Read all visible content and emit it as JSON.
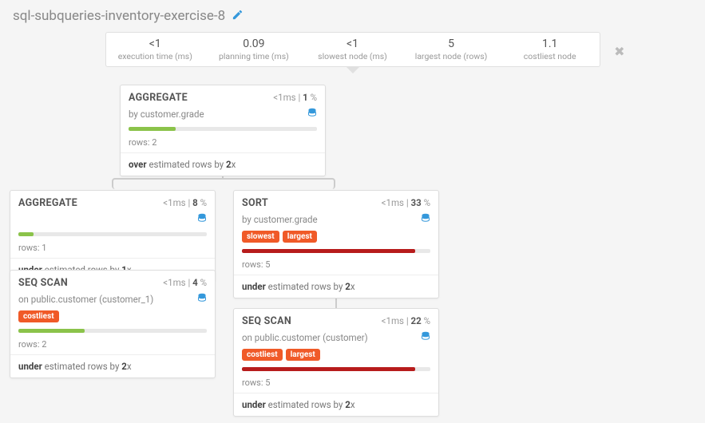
{
  "title": "sql-subqueries-inventory-exercise-8",
  "stats": [
    {
      "value": "<1",
      "label": "execution time (ms)"
    },
    {
      "value": "0.09",
      "label": "planning time (ms)"
    },
    {
      "value": "<1",
      "label": "slowest node (ms)"
    },
    {
      "value": "5",
      "label": "largest node (rows)"
    },
    {
      "value": "1.1",
      "label": "costliest node"
    }
  ],
  "nodes": {
    "agg_top": {
      "name": "AGGREGATE",
      "time": "<1",
      "pct": "1",
      "sub_prefix": "by ",
      "sub": "customer.grade",
      "bar_color": "green",
      "bar_width": "25%",
      "rows": "2",
      "est_prefix": "over",
      "est_mid": " estimated rows by ",
      "est_val": "2",
      "est_suffix": "x",
      "tags": []
    },
    "agg_left": {
      "name": "AGGREGATE",
      "time": "<1",
      "pct": "8",
      "sub_prefix": "",
      "sub": "",
      "bar_color": "green",
      "bar_width": "8%",
      "rows": "1",
      "est_prefix": "under",
      "est_mid": " estimated rows by ",
      "est_val": "1",
      "est_suffix": "x",
      "tags": []
    },
    "seq_left": {
      "name": "SEQ SCAN",
      "time": "<1",
      "pct": "4",
      "sub_prefix": "on ",
      "sub": "public.customer (customer_1)",
      "bar_color": "green",
      "bar_width": "35%",
      "rows": "2",
      "est_prefix": "under",
      "est_mid": " estimated rows by ",
      "est_val": "2",
      "est_suffix": "x",
      "tags": [
        "costliest"
      ]
    },
    "sort_right": {
      "name": "SORT",
      "time": "<1",
      "pct": "33",
      "sub_prefix": "by ",
      "sub": "customer.grade",
      "bar_color": "red",
      "bar_width": "92%",
      "rows": "5",
      "est_prefix": "under",
      "est_mid": " estimated rows by ",
      "est_val": "2",
      "est_suffix": "x",
      "tags": [
        "slowest",
        "largest"
      ]
    },
    "seq_right": {
      "name": "SEQ SCAN",
      "time": "<1",
      "pct": "22",
      "sub_prefix": "on ",
      "sub": "public.customer (customer)",
      "bar_color": "red",
      "bar_width": "92%",
      "rows": "5",
      "est_prefix": "under",
      "est_mid": " estimated rows by ",
      "est_val": "2",
      "est_suffix": "x",
      "tags": [
        "costliest",
        "largest"
      ]
    }
  },
  "labels": {
    "rows_prefix": "rows: ",
    "ms": "ms",
    "sep": " | ",
    "pct": " %"
  }
}
